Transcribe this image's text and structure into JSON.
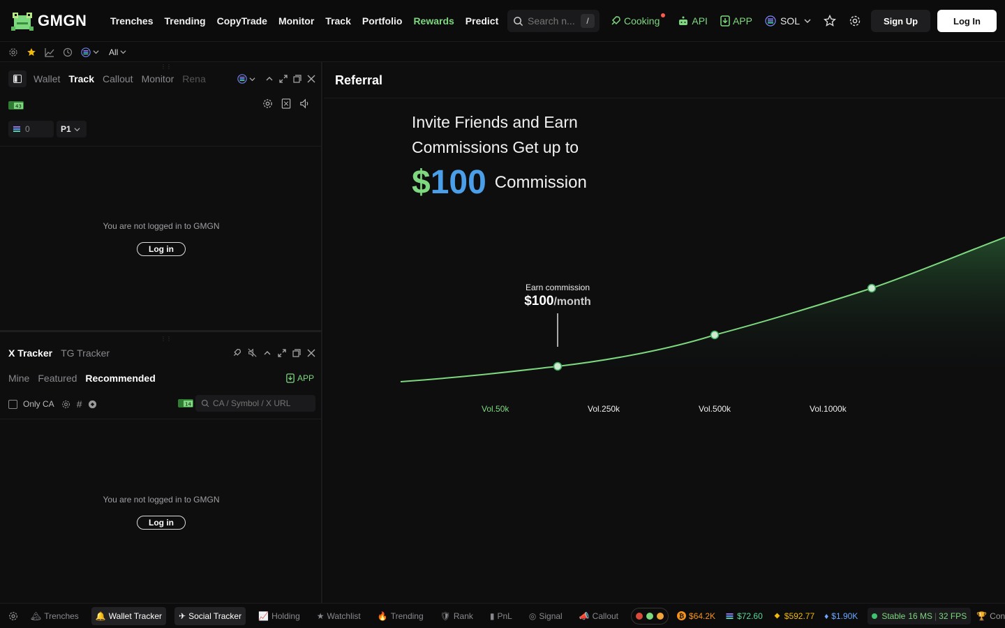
{
  "brand": {
    "name": "GMGN"
  },
  "nav": {
    "items": [
      {
        "label": "Trenches"
      },
      {
        "label": "Trending"
      },
      {
        "label": "CopyTrade"
      },
      {
        "label": "Monitor"
      },
      {
        "label": "Track"
      },
      {
        "label": "Portfolio"
      },
      {
        "label": "Rewards"
      },
      {
        "label": "Predict"
      }
    ]
  },
  "search": {
    "placeholder": "Search n...",
    "shortcut": "/"
  },
  "topright": {
    "cooking": "Cooking",
    "api": "API",
    "app": "APP",
    "chain": "SOL"
  },
  "auth": {
    "signup": "Sign Up",
    "login": "Log In"
  },
  "subbar": {
    "filter": "All"
  },
  "wallet_panel": {
    "tabs": [
      "Wallet",
      "Track",
      "Callout",
      "Monitor",
      "Rena"
    ],
    "active_tab": "Track",
    "balance": "0",
    "preset": "P1",
    "not_logged": "You are not logged in to GMGN",
    "login": "Log in"
  },
  "x_tracker": {
    "tabs": [
      "X Tracker",
      "TG Tracker"
    ],
    "subtabs": [
      "Mine",
      "Featured",
      "Recommended"
    ],
    "app_label": "APP",
    "only_ca": "Only CA",
    "search_placeholder": "CA / Symbol / X URL",
    "not_logged": "You are not logged in to GMGN",
    "login": "Log in"
  },
  "referral": {
    "title": "Referral",
    "headline_line1": "Invite Friends and Earn",
    "headline_line2": "Commissions Get up to",
    "amount_dollar": "$",
    "amount_value": "100",
    "amount_suffix": "Commission",
    "annotation_label": "Earn commission",
    "annotation_value": "$100",
    "annotation_unit": "/month"
  },
  "chart_data": {
    "type": "area",
    "categories": [
      "Vol.50k",
      "Vol.250k",
      "Vol.500k",
      "Vol.1000k"
    ],
    "highlighted_category": "Vol.50k",
    "points": [
      {
        "x": "Vol.50k",
        "marker": true
      },
      {
        "x": "Vol.250k",
        "marker": true
      },
      {
        "x": "Vol.500k",
        "marker": true
      }
    ],
    "series_color": "#7ed87f"
  },
  "bottombar": {
    "items": [
      {
        "label": "Trenches",
        "active": false
      },
      {
        "label": "Wallet Tracker",
        "active": true
      },
      {
        "label": "Social Tracker",
        "active": true
      },
      {
        "label": "Holding",
        "active": false
      },
      {
        "label": "Watchlist",
        "active": false
      },
      {
        "label": "Trending",
        "active": false
      },
      {
        "label": "Rank",
        "active": false
      },
      {
        "label": "PnL",
        "active": false
      },
      {
        "label": "Signal",
        "active": false
      },
      {
        "label": "Callout",
        "active": false
      }
    ],
    "prices": {
      "btc": "$64.2K",
      "sol": "$72.60",
      "bnb": "$592.77",
      "eth": "$1.90K"
    },
    "status": "Stable",
    "latency": "16 MS",
    "fps": "32 FPS",
    "contest": "Contest"
  },
  "colors": {
    "accent_green": "#7ed87f",
    "accent_blue": "#4a9fe8",
    "btc_orange": "#f7931a",
    "bnb_yellow": "#f0b90b"
  }
}
